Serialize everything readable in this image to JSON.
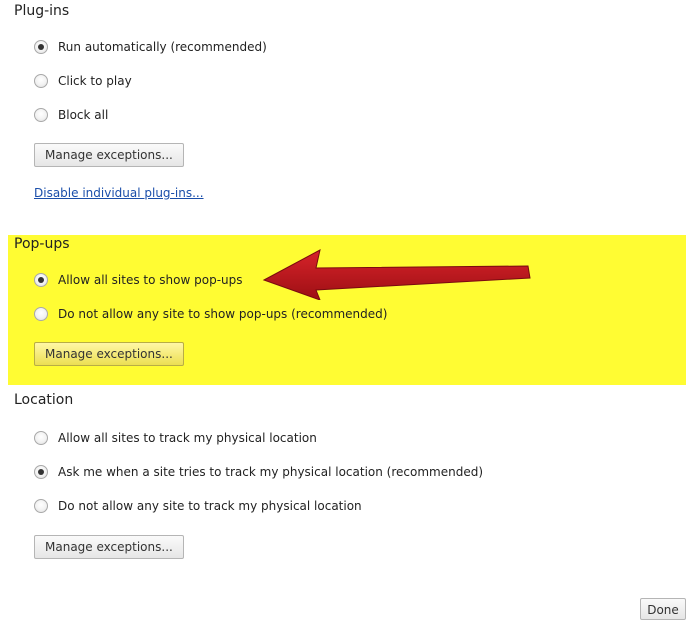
{
  "plugins": {
    "title": "Plug-ins",
    "options": [
      {
        "label": "Run automatically (recommended)",
        "checked": true
      },
      {
        "label": "Click to play",
        "checked": false
      },
      {
        "label": "Block all",
        "checked": false
      }
    ],
    "manage_label": "Manage exceptions...",
    "disable_link": "Disable individual plug-ins..."
  },
  "popups": {
    "title": "Pop-ups",
    "options": [
      {
        "label": "Allow all sites to show pop-ups",
        "checked": true
      },
      {
        "label": "Do not allow any site to show pop-ups (recommended)",
        "checked": false
      }
    ],
    "manage_label": "Manage exceptions...",
    "highlight_color": "#fffc33",
    "arrow_color": "#c0151b"
  },
  "location": {
    "title": "Location",
    "options": [
      {
        "label": "Allow all sites to track my physical location",
        "checked": false
      },
      {
        "label": "Ask me when a site tries to track my physical location (recommended)",
        "checked": true
      },
      {
        "label": "Do not allow any site to track my physical location",
        "checked": false
      }
    ],
    "manage_label": "Manage exceptions..."
  },
  "footer": {
    "done_label": "Done"
  }
}
